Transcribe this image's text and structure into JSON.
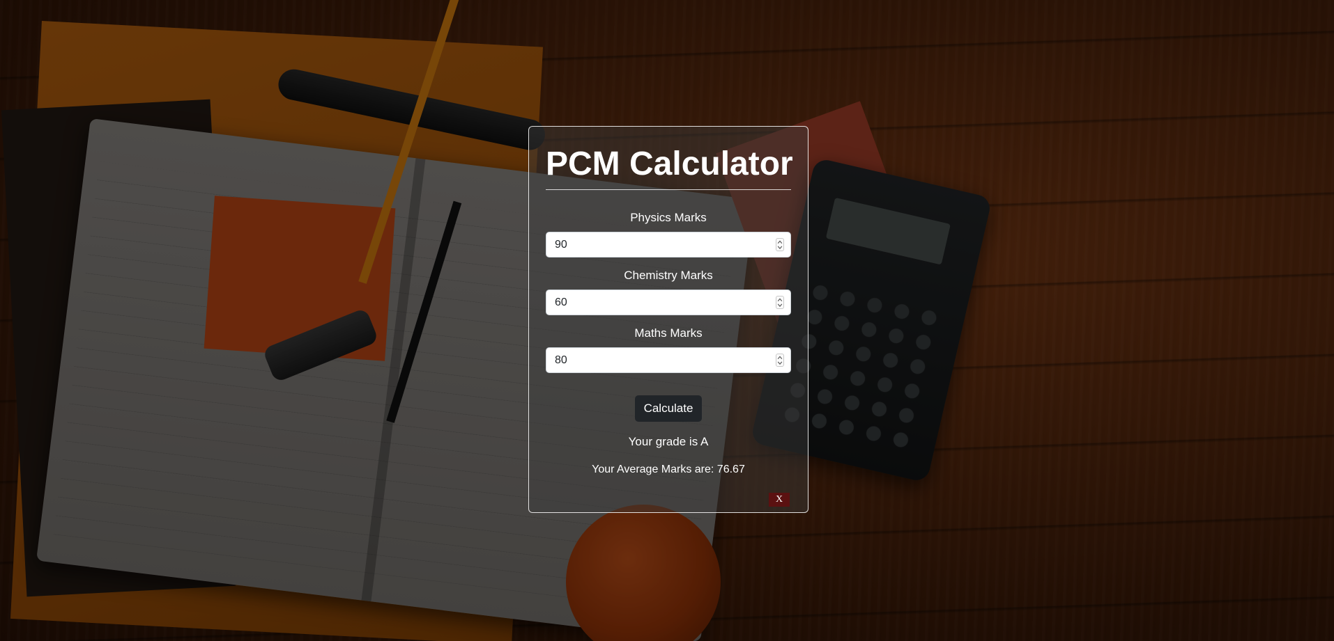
{
  "calculator": {
    "title": "PCM Calculator",
    "fields": [
      {
        "label": "Physics Marks",
        "value": "90"
      },
      {
        "label": "Chemistry Marks",
        "value": "60"
      },
      {
        "label": "Maths Marks",
        "value": "80"
      }
    ],
    "calculate_label": "Calculate",
    "grade_text": "Your grade is A",
    "average_text": "Your Average Marks are: 76.67",
    "close_label": "X"
  },
  "colors": {
    "button_bg": "#212529",
    "close_bg": "#5b1111",
    "card_border": "#ffffff"
  }
}
